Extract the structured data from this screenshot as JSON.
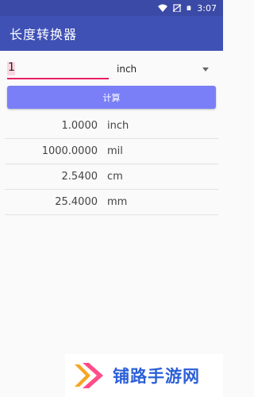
{
  "status_bar": {
    "time": "3:07",
    "icons": [
      "wifi-icon",
      "no-sim-icon",
      "battery-icon"
    ]
  },
  "app_bar": {
    "title": "长度转换器"
  },
  "input": {
    "value": "1",
    "placeholder": ""
  },
  "unit_select": {
    "selected": "inch",
    "options_visible": [
      "inch"
    ]
  },
  "calculate_button": {
    "label": "计算"
  },
  "results": [
    {
      "value": "1.0000",
      "unit": "inch"
    },
    {
      "value": "1000.0000",
      "unit": "mil"
    },
    {
      "value": "2.5400",
      "unit": "cm"
    },
    {
      "value": "25.4000",
      "unit": "mm"
    }
  ],
  "watermark": {
    "text": "铺路手游网"
  },
  "colors": {
    "status_bar": "#3a4aa6",
    "app_bar": "#3f51b5",
    "accent_underline": "#e91e63",
    "button": "#7b7ff7",
    "watermark_text": "#2b5fd8",
    "logo_orange": "#f5a623",
    "logo_pink": "#ff4d88"
  }
}
